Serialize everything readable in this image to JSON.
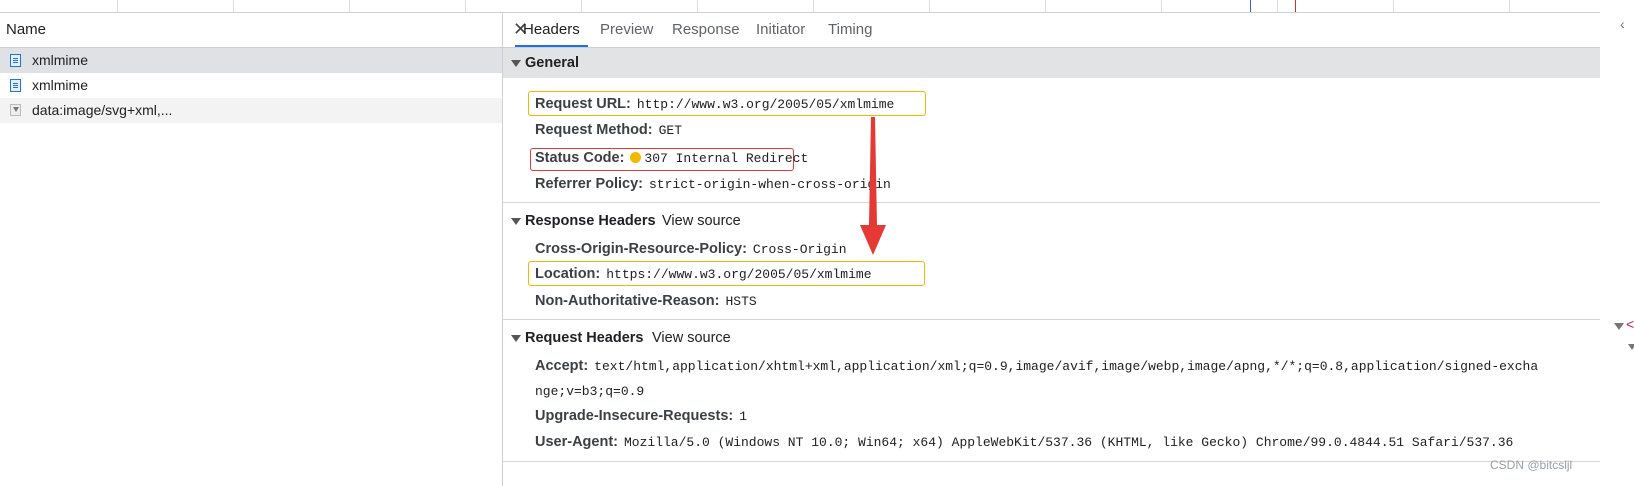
{
  "left_panel": {
    "header": "Name",
    "requests": [
      {
        "name": "xmlmime",
        "icon": "document-icon"
      },
      {
        "name": "xmlmime",
        "icon": "document-icon"
      },
      {
        "name": "data:image/svg+xml,...",
        "icon": "image-icon"
      }
    ]
  },
  "tabs": [
    "Headers",
    "Preview",
    "Response",
    "Initiator",
    "Timing"
  ],
  "active_tab": "Headers",
  "general": {
    "title": "General",
    "rows": [
      {
        "key": "Request URL:",
        "value": "http://www.w3.org/2005/05/xmlmime"
      },
      {
        "key": "Request Method:",
        "value": "GET"
      },
      {
        "key": "Status Code:",
        "value": "307 Internal Redirect"
      },
      {
        "key": "Referrer Policy:",
        "value": "strict-origin-when-cross-origin"
      }
    ]
  },
  "response_headers": {
    "title": "Response Headers",
    "view_source": "View source",
    "rows": [
      {
        "key": "Cross-Origin-Resource-Policy:",
        "value": "Cross-Origin"
      },
      {
        "key": "Location:",
        "value": "https://www.w3.org/2005/05/xmlmime"
      },
      {
        "key": "Non-Authoritative-Reason:",
        "value": "HSTS"
      }
    ]
  },
  "request_headers": {
    "title": "Request Headers",
    "view_source": "View source",
    "accept_key": "Accept:",
    "accept_value_line1": "text/html,application/xhtml+xml,application/xml;q=0.9,image/avif,image/webp,image/apng,*/*;q=0.8,application/signed-excha",
    "accept_value_line2": "nge;v=b3;q=0.9",
    "rows": [
      {
        "key": "Upgrade-Insecure-Requests:",
        "value": "1"
      },
      {
        "key": "User-Agent:",
        "value": "Mozilla/5.0 (Windows NT 10.0; Win64; x64) AppleWebKit/537.36 (KHTML, like Gecko) Chrome/99.0.4844.51 Safari/537.36"
      }
    ]
  },
  "colors": {
    "highlight_box": "#f2b800",
    "status_box": "#e53935",
    "arrow": "#e53935",
    "active_tab_underline": "#1a73e8"
  },
  "watermark": "CSDN @bitcsljl"
}
